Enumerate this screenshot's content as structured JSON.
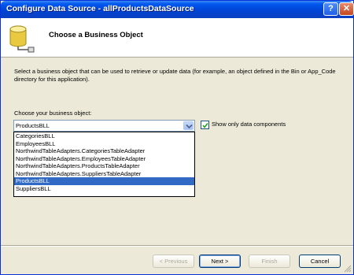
{
  "window": {
    "title": "Configure Data Source - allProductsDataSource"
  },
  "titlebar_buttons": {
    "help": "?",
    "close": "✕"
  },
  "header": {
    "title": "Choose a Business Object",
    "icon": "database-icon"
  },
  "description": "Select a business object that can be used to retrieve or update data (for example, an object defined in the Bin or App_Code directory for this application).",
  "combo": {
    "label": "Choose your business object:",
    "value": "ProductsBLL",
    "options": [
      "CategoriesBLL",
      "EmployeesBLL",
      "NorthwindTableAdapters.CategoriesTableAdapter",
      "NorthwindTableAdapters.EmployeesTableAdapter",
      "NorthwindTableAdapters.ProductsTableAdapter",
      "NorthwindTableAdapters.SuppliersTableAdapter",
      "ProductsBLL",
      "SuppliersBLL"
    ]
  },
  "show_only_data_components": {
    "label": "Show only data components",
    "checked": true
  },
  "buttons": {
    "previous": "< Previous",
    "next": "Next >",
    "finish": "Finish",
    "cancel": "Cancel"
  }
}
